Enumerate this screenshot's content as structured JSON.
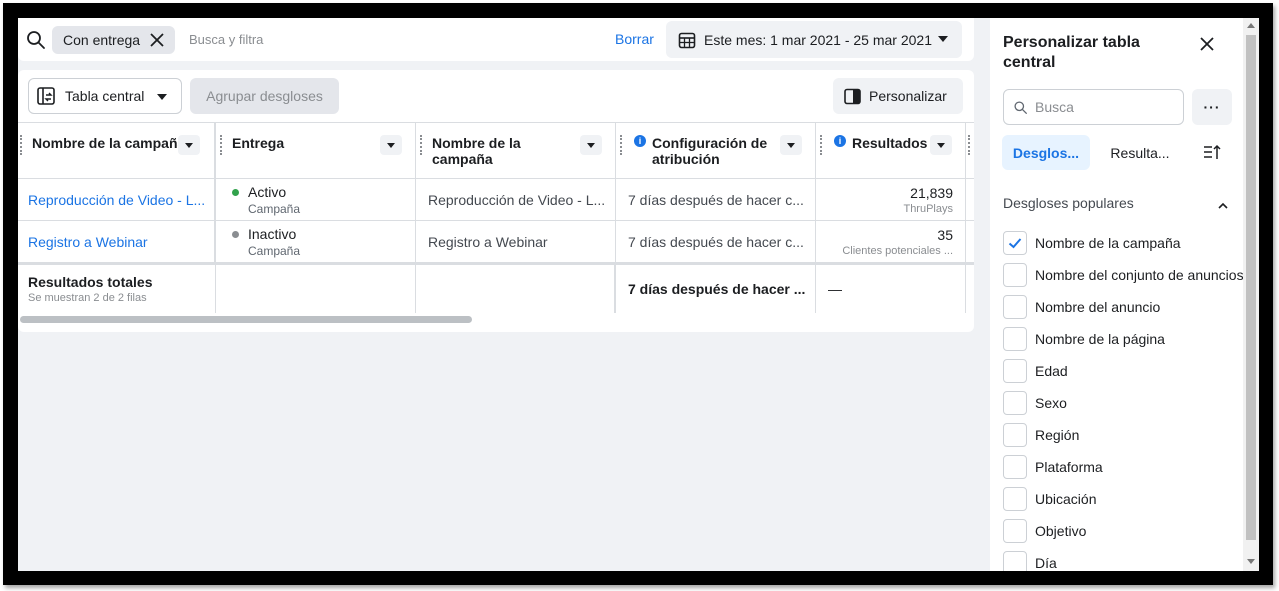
{
  "filterbar": {
    "chip_label": "Con entrega",
    "search_placeholder": "Busca y filtra",
    "clear_label": "Borrar",
    "date_range": "Este mes: 1 mar 2021 - 25 mar 2021"
  },
  "toolbar": {
    "table_label": "Tabla central",
    "group_label": "Agrupar desgloses",
    "customize_label": "Personalizar"
  },
  "table": {
    "columns": [
      {
        "label": "Nombre de la campaña"
      },
      {
        "label": "Entrega"
      },
      {
        "label": "Nombre de la campaña"
      },
      {
        "label": "Configuración de atribución"
      },
      {
        "label": "Resultados"
      }
    ],
    "rows": [
      {
        "campaign": "Reproducción de Video - L...",
        "status": "Activo",
        "status_sub": "Campaña",
        "status_color": "#31a24c",
        "campaign2": "Reproducción de Video - L...",
        "attribution": "7 días después de hacer c...",
        "result": "21,839",
        "result_sub": "ThruPlays"
      },
      {
        "campaign": "Registro a Webinar",
        "status": "Inactivo",
        "status_sub": "Campaña",
        "status_color": "#8a8d91",
        "campaign2": "Registro a Webinar",
        "attribution": "7 días después de hacer c...",
        "result": "35",
        "result_sub": "Clientes potenciales ..."
      }
    ],
    "totals": {
      "title": "Resultados totales",
      "subtitle": "Se muestran 2 de 2 filas",
      "attribution": "7 días después de hacer ...",
      "result": "—"
    }
  },
  "side": {
    "title": "Personalizar tabla central",
    "search_placeholder": "Busca",
    "more_label": "···",
    "tabs": [
      {
        "label": "Desglos..."
      },
      {
        "label": "Resulta..."
      }
    ],
    "section_title": "Desgloses populares",
    "options": [
      {
        "label": "Nombre de la campaña",
        "checked": true
      },
      {
        "label": "Nombre del conjunto de anuncios",
        "checked": false
      },
      {
        "label": "Nombre del anuncio",
        "checked": false
      },
      {
        "label": "Nombre de la página",
        "checked": false
      },
      {
        "label": "Edad",
        "checked": false
      },
      {
        "label": "Sexo",
        "checked": false
      },
      {
        "label": "Región",
        "checked": false
      },
      {
        "label": "Plataforma",
        "checked": false
      },
      {
        "label": "Ubicación",
        "checked": false
      },
      {
        "label": "Objetivo",
        "checked": false
      },
      {
        "label": "Día",
        "checked": false
      }
    ]
  },
  "colors": {
    "accent": "#1b74e4",
    "active_tab_bg": "#e7f3ff",
    "active_status": "#31a24c",
    "inactive_status": "#8a8d91"
  }
}
